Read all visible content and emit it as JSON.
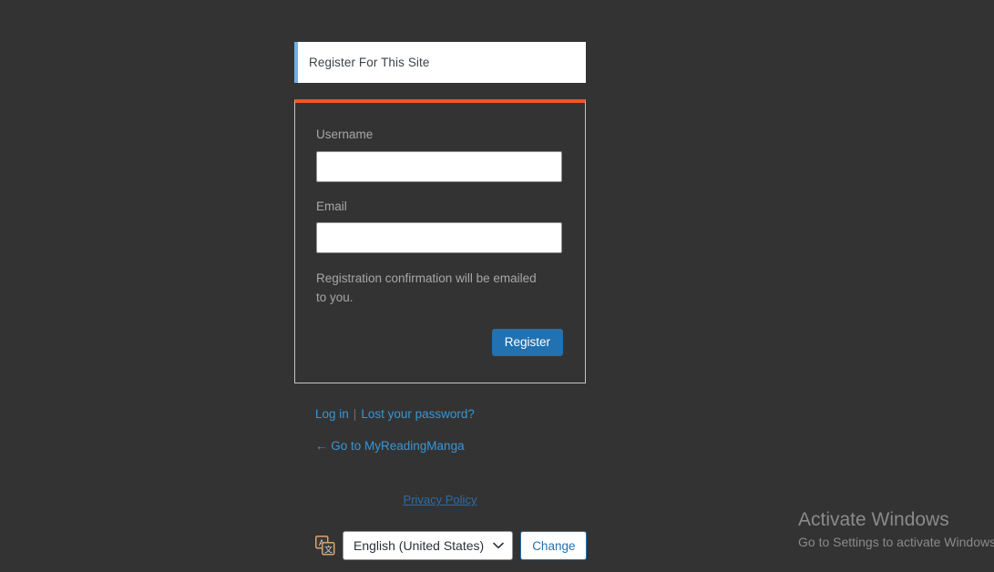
{
  "colors": {
    "page_background": "#333333",
    "message_accent": "#72aee6",
    "form_top_border": "#ef5524",
    "form_border": "#c3c4c7",
    "primary_button": "#2271b1",
    "link": "#3996d6",
    "label_text": "#a7a7a7",
    "privacy_link": "#2c6ca8",
    "watermark_text": "#8a8a8a"
  },
  "message": {
    "text": "Register For This Site"
  },
  "form": {
    "username": {
      "label": "Username",
      "value": "",
      "placeholder": ""
    },
    "email": {
      "label": "Email",
      "value": "",
      "placeholder": ""
    },
    "note": "Registration confirmation will be emailed to you.",
    "submit_label": "Register"
  },
  "nav": {
    "login_label": "Log in",
    "separator": "|",
    "lost_password_label": "Lost your password?",
    "back_to_blog_label": "← Go to MyReadingManga"
  },
  "privacy": {
    "link_label": "Privacy Policy"
  },
  "language_switcher": {
    "icon": "translate-icon",
    "icon_glyph_primary": "A",
    "icon_glyph_secondary": "文",
    "selected_language": "English (United States)",
    "chevron": "chevron-down-icon",
    "change_label": "Change"
  },
  "windows_watermark": {
    "title": "Activate Windows",
    "subtitle": "Go to Settings to activate Windows."
  }
}
